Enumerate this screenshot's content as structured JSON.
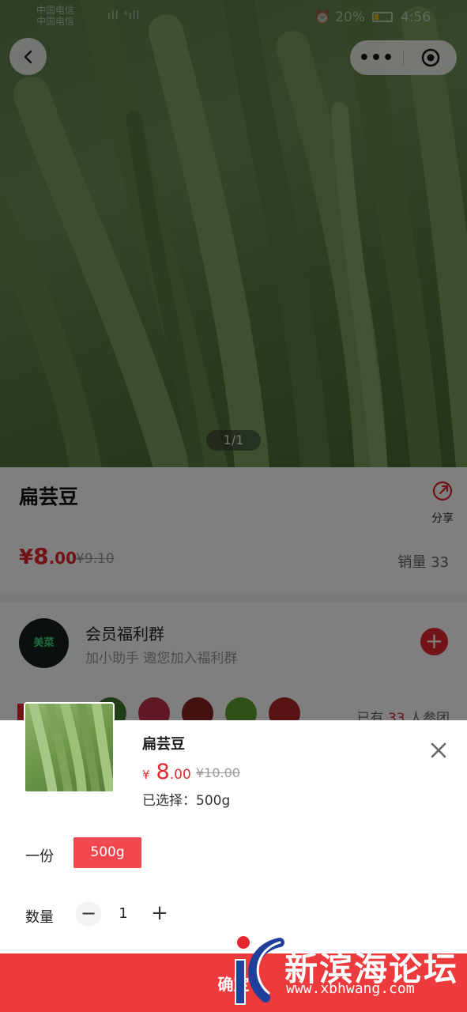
{
  "status_bar": {
    "carrier_1": "中国电信",
    "carrier_2": "中国电信",
    "signal": "ıll ⁴ıll",
    "alarm_icon": "alarm-icon",
    "battery_percent": "20%",
    "time": "4:56"
  },
  "nav": {
    "back_icon": "chevron-left-icon",
    "more_label": "•••",
    "target_icon": "target-icon"
  },
  "gallery": {
    "pager": "1/1"
  },
  "product": {
    "title": "扁芸豆",
    "share_label": "分享",
    "price_symbol": "¥",
    "price_int": "8",
    "price_dec": ".00",
    "original_price": "¥9.10",
    "sales": "销量 33"
  },
  "group": {
    "avatar_text": "美菜",
    "name": "会员福利群",
    "desc": "加小助手 邀您加入福利群",
    "add_label": "+",
    "joined_prefix": "已有",
    "joined_count": "33",
    "joined_suffix": "人参团"
  },
  "sheet": {
    "name": "扁芸豆",
    "price_symbol": "¥",
    "price_int": "8",
    "price_dec": ".00",
    "original_price": "¥10.00",
    "selected": "已选择：500g",
    "spec_label": "一份",
    "spec_option": "500g",
    "qty_label": "数量",
    "qty_minus": "−",
    "qty_value": "1",
    "qty_plus": "+",
    "confirm_label": "确定"
  },
  "watermark": {
    "name": "新滨海论坛",
    "url": "www.xbhwang.com"
  },
  "colors": {
    "accent": "#e5262e",
    "confirm_bg": "#ed3a3d"
  }
}
